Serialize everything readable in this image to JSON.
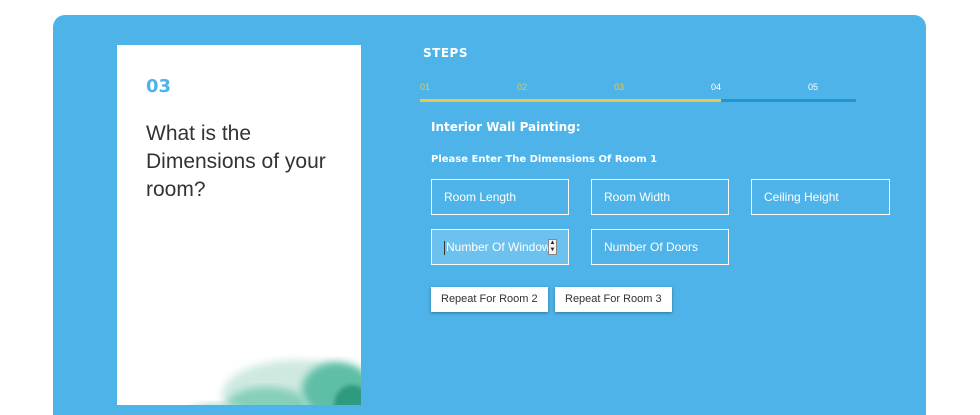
{
  "colors": {
    "panel_bg": "#4eb3e8",
    "accent": "#e9c84a",
    "track": "#2196d3",
    "text_dark": "#333333"
  },
  "card": {
    "step_number": "03",
    "question": "What is the Dimensions of your room?"
  },
  "steps": {
    "title": "STEPS",
    "items": [
      {
        "label": "01",
        "done": true
      },
      {
        "label": "02",
        "done": true
      },
      {
        "label": "03",
        "done": true
      },
      {
        "label": "04",
        "done": false
      },
      {
        "label": "05",
        "done": false
      }
    ],
    "progress_fraction": 0.69
  },
  "form": {
    "section_title": "Interior Wall Painting:",
    "room_title": "Please Enter The Dimensions Of Room 1",
    "fields": {
      "room_length": "Room Length",
      "room_width": "Room Width",
      "ceiling_height": "Ceiling Height",
      "number_of_windows": "Number Of Windows",
      "number_of_doors": "Number Of Doors"
    },
    "buttons": {
      "repeat_room_2": "Repeat For Room 2",
      "repeat_room_3": "Repeat For Room 3"
    }
  },
  "icons": {
    "spinner": "number-spinner-icon",
    "splash": "watercolor-splash"
  }
}
